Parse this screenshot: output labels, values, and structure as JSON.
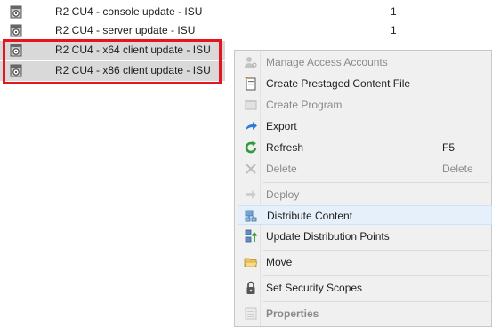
{
  "list": {
    "rows": [
      {
        "name": "R2 CU4 - console update - ISU",
        "count": "1"
      },
      {
        "name": "R2 CU4 - server update - ISU",
        "count": "1"
      },
      {
        "name": "R2 CU4 - x64 client update - ISU",
        "count": ""
      },
      {
        "name": "R2 CU4 - x86 client update - ISU",
        "count": ""
      }
    ]
  },
  "context_menu": {
    "items": [
      {
        "label": "Manage Access Accounts",
        "icon": "people-key-icon",
        "disabled": true
      },
      {
        "label": "Create Prestaged Content File",
        "icon": "prestaged-file-icon",
        "disabled": false
      },
      {
        "label": "Create Program",
        "icon": "program-icon",
        "disabled": true
      },
      {
        "label": "Export",
        "icon": "export-arrow-icon",
        "disabled": false
      },
      {
        "label": "Refresh",
        "icon": "refresh-icon",
        "shortcut": "F5",
        "disabled": false
      },
      {
        "label": "Delete",
        "icon": "delete-x-icon",
        "shortcut": "Delete",
        "disabled": true
      },
      {
        "label": "Deploy",
        "icon": "deploy-arrow-icon",
        "disabled": true
      },
      {
        "label": "Distribute Content",
        "icon": "distribute-content-icon",
        "disabled": false
      },
      {
        "label": "Update Distribution Points",
        "icon": "update-dp-icon",
        "disabled": false
      },
      {
        "label": "Move",
        "icon": "folder-move-icon",
        "disabled": false
      },
      {
        "label": "Set Security Scopes",
        "icon": "lock-scope-icon",
        "disabled": false
      },
      {
        "label": "Properties",
        "icon": "properties-icon",
        "disabled": true
      }
    ]
  },
  "colors": {
    "highlight_box": "#e8141d",
    "selected_row": "#d9d9d9",
    "menu_bg": "#f0f0f0",
    "menu_hover": "#e5f0fb",
    "export_blue": "#2b7bd8",
    "refresh_green": "#2e9b3a"
  }
}
